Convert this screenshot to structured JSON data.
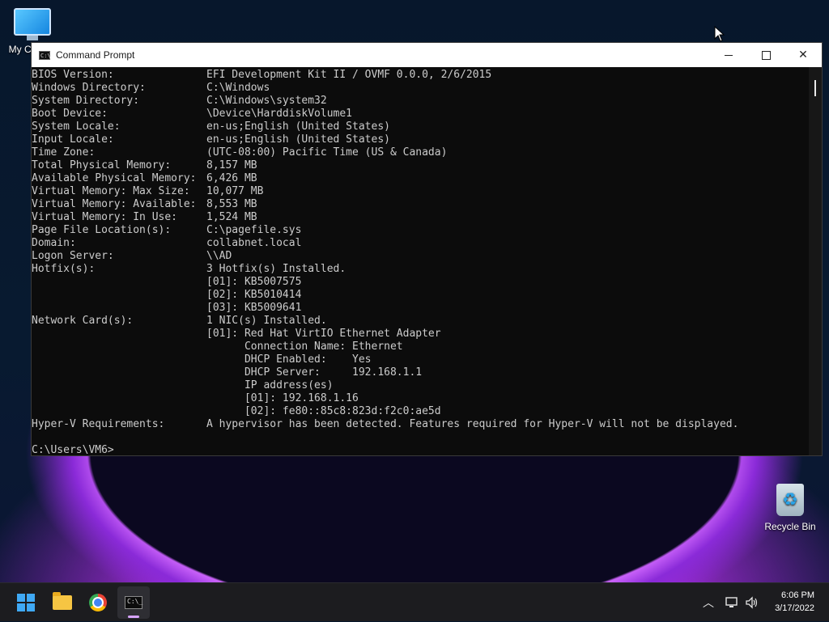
{
  "desktop": {
    "icons": [
      {
        "label": "My Co"
      },
      {
        "label": "Recycle Bin"
      }
    ]
  },
  "window": {
    "title": "Command Prompt",
    "icon": "cmd-icon",
    "buttons": [
      "minimize-icon",
      "maximize-icon",
      "close-icon"
    ]
  },
  "console": {
    "lines": [
      {
        "label": "BIOS Version:",
        "value": "EFI Development Kit II / OVMF 0.0.0, 2/6/2015"
      },
      {
        "label": "Windows Directory:",
        "value": "C:\\Windows"
      },
      {
        "label": "System Directory:",
        "value": "C:\\Windows\\system32"
      },
      {
        "label": "Boot Device:",
        "value": "\\Device\\HarddiskVolume1"
      },
      {
        "label": "System Locale:",
        "value": "en-us;English (United States)"
      },
      {
        "label": "Input Locale:",
        "value": "en-us;English (United States)"
      },
      {
        "label": "Time Zone:",
        "value": "(UTC-08:00) Pacific Time (US & Canada)"
      },
      {
        "label": "Total Physical Memory:",
        "value": "8,157 MB"
      },
      {
        "label": "Available Physical Memory:",
        "value": "6,426 MB"
      },
      {
        "label": "Virtual Memory: Max Size:",
        "value": "10,077 MB"
      },
      {
        "label": "Virtual Memory: Available:",
        "value": "8,553 MB"
      },
      {
        "label": "Virtual Memory: In Use:",
        "value": "1,524 MB"
      },
      {
        "label": "Page File Location(s):",
        "value": "C:\\pagefile.sys"
      },
      {
        "label": "Domain:",
        "value": "collabnet.local"
      },
      {
        "label": "Logon Server:",
        "value": "\\\\AD"
      },
      {
        "label": "Hotfix(s):",
        "value": "3 Hotfix(s) Installed."
      },
      {
        "label": "",
        "value": "[01]: KB5007575"
      },
      {
        "label": "",
        "value": "[02]: KB5010414"
      },
      {
        "label": "",
        "value": "[03]: KB5009641"
      },
      {
        "label": "Network Card(s):",
        "value": "1 NIC(s) Installed."
      },
      {
        "label": "",
        "value": "[01]: Red Hat VirtIO Ethernet Adapter"
      },
      {
        "label": "",
        "value": "      Connection Name: Ethernet"
      },
      {
        "label": "",
        "value": "      DHCP Enabled:    Yes"
      },
      {
        "label": "",
        "value": "      DHCP Server:     192.168.1.1"
      },
      {
        "label": "",
        "value": "      IP address(es)"
      },
      {
        "label": "",
        "value": "      [01]: 192.168.1.16"
      },
      {
        "label": "",
        "value": "      [02]: fe80::85c8:823d:f2c0:ae5d"
      },
      {
        "label": "Hyper-V Requirements:",
        "value": "A hypervisor has been detected. Features required for Hyper-V will not be displayed."
      },
      {
        "label": "",
        "value": ""
      }
    ],
    "prompt": "C:\\Users\\VM6>"
  },
  "taskbar": {
    "apps": [
      "start-icon",
      "file-explorer-icon",
      "chrome-icon",
      "command-prompt-icon"
    ],
    "tray_icons": [
      "chevron-up-icon",
      "network-icon",
      "volume-icon"
    ],
    "time": "6:06 PM",
    "date": "3/17/2022"
  }
}
